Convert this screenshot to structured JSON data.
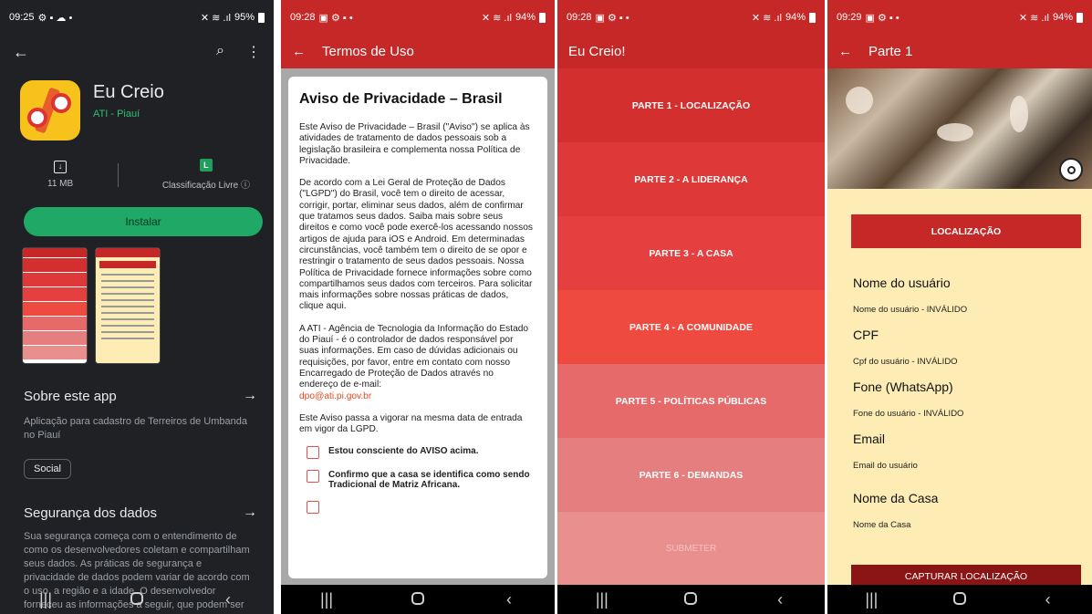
{
  "panel1": {
    "status": {
      "time": "09:25",
      "battery": "95%"
    },
    "app": {
      "name": "Eu Creio",
      "developer": "ATI - Piauí",
      "size": "11 MB",
      "rating": "Classificação Livre ⓘ",
      "rating_badge": "L",
      "install_label": "Instalar"
    },
    "about": {
      "title": "Sobre este app",
      "text": "Aplicação para cadastro de Terreiros de Umbanda no Piauí",
      "tag": "Social"
    },
    "safety": {
      "title": "Segurança dos dados",
      "text": "Sua segurança começa com o entendimento de como os desenvolvedores coletam e compartilham seus dados. As práticas de segurança e privacidade de dados podem variar de acordo com o uso, a região e a idade. O desenvolvedor forneceu as informações a seguir, que podem ser"
    }
  },
  "panel2": {
    "status": {
      "time": "09:28",
      "battery": "94%"
    },
    "title": "Termos de Uso",
    "heading": "Aviso de Privacidade – Brasil",
    "para1": "Este Aviso de Privacidade – Brasil (\"Aviso\") se aplica às atividades de tratamento de dados pessoais sob a legislação brasileira e complementa nossa Política de Privacidade.",
    "para2": "De acordo com a Lei Geral de Proteção de Dados (\"LGPD\") do Brasil, você tem o direito de acessar, corrigir, portar, eliminar seus dados, além de confirmar que tratamos seus dados. Saiba mais sobre seus direitos e como você pode exercê-los acessando nossos artigos de ajuda para iOS e Android. Em determinadas circunstâncias, você também tem o direito de se opor e restringir o tratamento de seus dados pessoais. Nossa Política de Privacidade fornece informações sobre como compartilhamos seus dados com terceiros. Para solicitar mais informações sobre nossas práticas de dados, clique aqui.",
    "para3": "A ATI - Agência de Tecnologia da Informação do Estado do Piauí - é o controlador de dados responsável por suas informações. Em caso de dúvidas adicionais ou requisições, por favor, entre em contato com nosso Encarregado de Proteção de Dados através no endereço de e-mail:",
    "email": "dpo@ati.pi.gov.br",
    "para4": "Este Aviso passa a vigorar na mesma data de entrada em vigor da LGPD.",
    "check1": "Estou consciente do AVISO acima.",
    "check2": "Confirmo que a casa se identifica como sendo Tradicional de Matriz Africana."
  },
  "panel3": {
    "status": {
      "time": "09:28",
      "battery": "94%"
    },
    "title": "Eu Creio!",
    "parts": [
      {
        "label": "PARTE 1 - LOCALIZAÇÃO",
        "color": "#d32f2f"
      },
      {
        "label": "PARTE 2 - A LIDERANÇA",
        "color": "#de3838"
      },
      {
        "label": "PARTE 3 - A CASA",
        "color": "#e53f3f"
      },
      {
        "label": "PARTE 4 - A COMUNIDADE",
        "color": "#ef4a40"
      },
      {
        "label": "PARTE 5 - POLÍTICAS PÚBLICAS",
        "color": "#e76a6a"
      },
      {
        "label": "PARTE 6 - DEMANDAS",
        "color": "#e57f7f"
      }
    ],
    "submit_label": "SUBMETER"
  },
  "panel4": {
    "status": {
      "time": "09:29",
      "battery": "94%"
    },
    "title": "Parte 1",
    "loc_button": "LOCALIZAÇÃO",
    "fields": [
      {
        "label": "Nome do usuário",
        "value": "Nome do usuário - INVÁLIDO"
      },
      {
        "label": "CPF",
        "value": "Cpf do usuário - INVÁLIDO"
      },
      {
        "label": "Fone (WhatsApp)",
        "value": "Fone do usuário - INVÁLIDO"
      },
      {
        "label": "Email",
        "value": "Email do usuário"
      },
      {
        "label": "Nome da Casa",
        "value": "Nome da Casa"
      }
    ],
    "capture_button": "CAPTURAR LOCALIZAÇÃO"
  }
}
